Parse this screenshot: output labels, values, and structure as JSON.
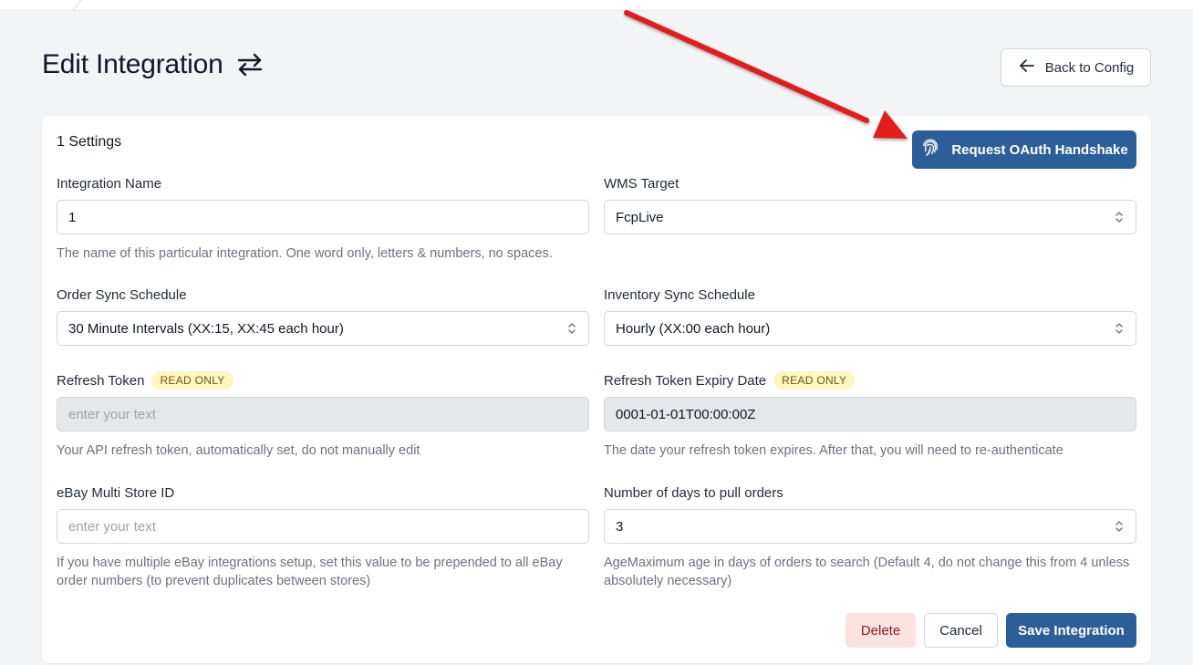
{
  "header": {
    "title": "Edit Integration",
    "back_label": "Back to Config"
  },
  "card": {
    "settings_title": "1 Settings",
    "oauth_label": "Request OAuth Handshake"
  },
  "fields": {
    "integration_name": {
      "label": "Integration Name",
      "value": "1",
      "help": "The name of this particular integration. One word only, letters & numbers, no spaces."
    },
    "wms_target": {
      "label": "WMS Target",
      "value": "FcpLive"
    },
    "order_sync": {
      "label": "Order Sync Schedule",
      "value": "30 Minute Intervals (XX:15, XX:45 each hour)"
    },
    "inventory_sync": {
      "label": "Inventory Sync Schedule",
      "value": "Hourly (XX:00 each hour)"
    },
    "refresh_token": {
      "label": "Refresh Token",
      "badge": "READ ONLY",
      "placeholder": "enter your text",
      "help": "Your API refresh token, automatically set, do not manually edit"
    },
    "refresh_expiry": {
      "label": "Refresh Token Expiry Date",
      "badge": "READ ONLY",
      "value": "0001-01-01T00:00:00Z",
      "help": "The date your refresh token expires. After that, you will need to re-authenticate"
    },
    "multi_store": {
      "label": "eBay Multi Store ID",
      "placeholder": "enter your text",
      "help": "If you have multiple eBay integrations setup, set this value to be prepended to all eBay order numbers (to prevent duplicates between stores)"
    },
    "days_to_pull": {
      "label": "Number of days to pull orders",
      "value": "3",
      "help": "AgeMaximum age in days of orders to search (Default 4, do not change this from 4 unless absolutely necessary)"
    }
  },
  "footer": {
    "delete_label": "Delete",
    "cancel_label": "Cancel",
    "save_label": "Save Integration"
  },
  "colors": {
    "primary": "#2c5f97",
    "annotation_arrow": "#e31b1b",
    "badge_bg": "#fdf6c3",
    "delete_bg": "#fde2e2"
  },
  "icons": {
    "title": "swap-arrows-icon",
    "back": "arrow-left-icon",
    "oauth": "fingerprint-icon",
    "select": "chevron-up-down-icon"
  }
}
